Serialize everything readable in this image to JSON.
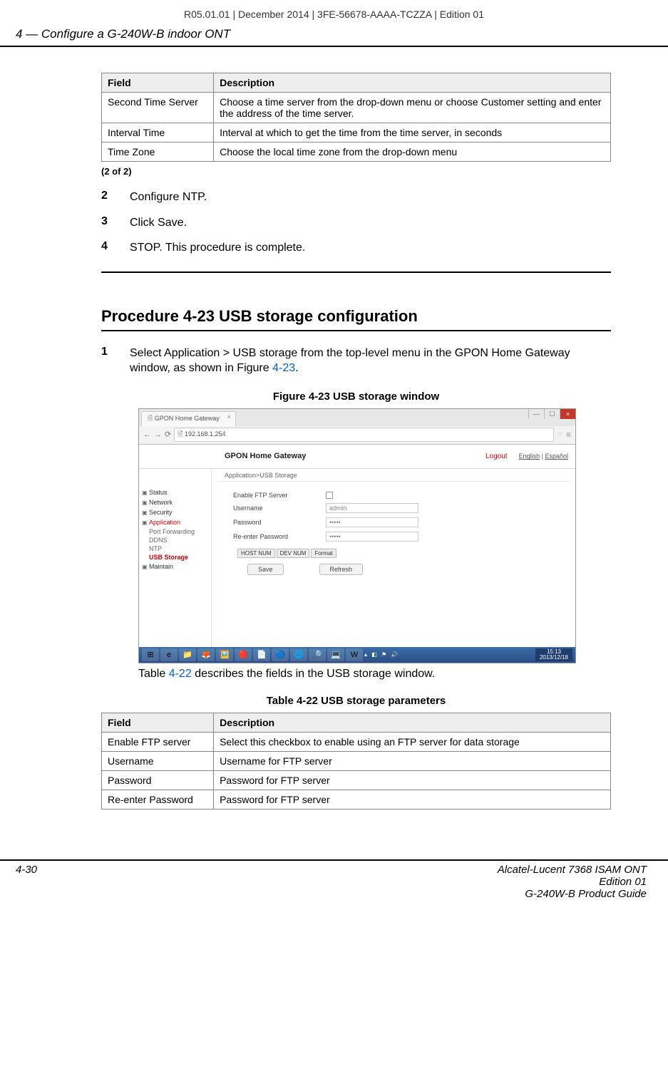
{
  "top_header": "R05.01.01 | December 2014 | 3FE-56678-AAAA-TCZZA | Edition 01",
  "chapter_header": "4 —  Configure a G-240W-B indoor ONT",
  "table1": {
    "h_field": "Field",
    "h_desc": "Description",
    "rows": [
      {
        "f": "Second Time Server",
        "d": "Choose a time server from the drop-down menu or choose Customer setting and enter the address of the time server."
      },
      {
        "f": "Interval Time",
        "d": "Interval at which to get the time from the time server, in seconds"
      },
      {
        "f": "Time Zone",
        "d": "Choose the local time zone from the drop-down menu"
      }
    ],
    "page": "(2 of 2)"
  },
  "steps_a": [
    {
      "n": "2",
      "t": "Configure NTP."
    },
    {
      "n": "3",
      "t": "Click Save."
    },
    {
      "n": "4",
      "t": "STOP. This procedure is complete."
    }
  ],
  "procedure_heading": "Procedure 4-23  USB storage configuration",
  "step1": {
    "n": "1",
    "pre": "Select Application > USB storage from the top-level menu in the GPON Home Gateway window, as shown in Figure ",
    "link": "4-23",
    "post": "."
  },
  "fig_caption": "Figure 4-23  USB storage window",
  "browser": {
    "tab": "GPON Home Gateway",
    "url": "192.168.1.254"
  },
  "gpon": {
    "title": "GPON Home Gateway",
    "logout": "Logout",
    "lang_en": "English",
    "lang_es": "Español",
    "breadcrumb": "Application>USB Storage",
    "sidebar": {
      "status": "Status",
      "network": "Network",
      "security": "Security",
      "application": "Application",
      "portfwd": "Port Forwarding",
      "ddns": "DDNS",
      "ntp": "NTP",
      "usb": "USB Storage",
      "maintain": "Maintain"
    },
    "form": {
      "enable_ftp": "Enable FTP Server",
      "username_lbl": "Username",
      "username_val": "admin",
      "password_lbl": "Password",
      "password_val": "•••••",
      "repassword_lbl": "Re-enter Password",
      "repassword_val": "•••••",
      "col_host": "HOST NUM",
      "col_dev": "DEV NUM",
      "col_format": "Format",
      "btn_save": "Save",
      "btn_refresh": "Refresh"
    }
  },
  "taskbar": {
    "time": "15:13",
    "date": "2013/12/18"
  },
  "after_fig": {
    "pre": "Table ",
    "link": "4-22",
    "post": " describes the fields in the USB storage window."
  },
  "tbl_caption": "Table 4-22 USB storage parameters",
  "table2": {
    "h_field": "Field",
    "h_desc": "Description",
    "rows": [
      {
        "f": "Enable FTP server",
        "d": "Select this checkbox to enable using an FTP server for data storage"
      },
      {
        "f": "Username",
        "d": "Username for FTP server"
      },
      {
        "f": "Password",
        "d": "Password for FTP server"
      },
      {
        "f": "Re-enter Password",
        "d": "Password for FTP server"
      }
    ]
  },
  "footer": {
    "left": "4-30",
    "r1": "Alcatel-Lucent 7368 ISAM ONT",
    "r2": "Edition 01",
    "r3": "G-240W-B Product Guide"
  }
}
